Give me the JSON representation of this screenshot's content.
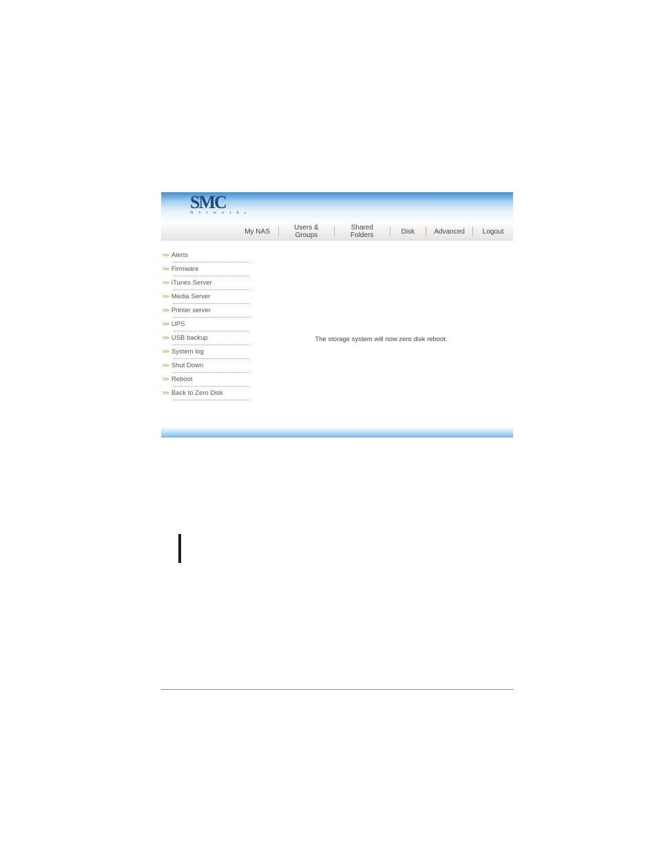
{
  "logo": {
    "main": "SMC",
    "sub": "N e t w o r k s"
  },
  "tabs": [
    {
      "label": "My NAS"
    },
    {
      "label": "Users & Groups"
    },
    {
      "label": "Shared Folders"
    },
    {
      "label": "Disk"
    },
    {
      "label": "Advanced"
    },
    {
      "label": "Logout"
    }
  ],
  "sidebar": {
    "items": [
      {
        "label": "Alerts"
      },
      {
        "label": "Firmware"
      },
      {
        "label": "iTunes Server"
      },
      {
        "label": "Media Server"
      },
      {
        "label": "Printer server"
      },
      {
        "label": "UPS"
      },
      {
        "label": "USB backup"
      },
      {
        "label": "System log"
      },
      {
        "label": "Shut Down"
      },
      {
        "label": "Reboot"
      },
      {
        "label": "Back to Zero Disk"
      }
    ]
  },
  "main": {
    "status": "The storage system will now zero disk reboot."
  }
}
